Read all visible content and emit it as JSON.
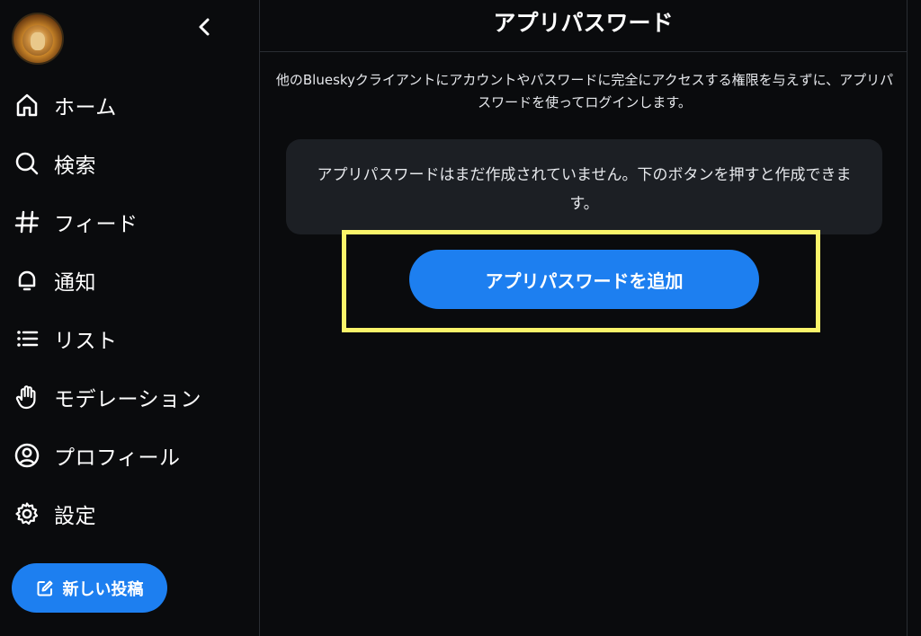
{
  "header": {
    "title": "アプリパスワード"
  },
  "main": {
    "description": "他のBlueskyクライアントにアカウントやパスワードに完全にアクセスする権限を与えずに、アプリパスワードを使ってログインします。",
    "empty_message": "アプリパスワードはまだ作成されていません。下のボタンを押すと作成できます。",
    "add_button_label": "アプリパスワードを追加"
  },
  "sidebar": {
    "items": [
      {
        "label": "ホーム",
        "icon": "home-icon"
      },
      {
        "label": "検索",
        "icon": "search-icon"
      },
      {
        "label": "フィード",
        "icon": "hash-icon"
      },
      {
        "label": "通知",
        "icon": "bell-icon"
      },
      {
        "label": "リスト",
        "icon": "list-icon"
      },
      {
        "label": "モデレーション",
        "icon": "hand-icon"
      },
      {
        "label": "プロフィール",
        "icon": "user-circle-icon"
      },
      {
        "label": "設定",
        "icon": "gear-icon"
      }
    ],
    "new_post_label": "新しい投稿"
  },
  "colors": {
    "background": "#0a0b0d",
    "accent": "#1d7ff0",
    "highlight": "#fbf46a",
    "card": "#1c1f24"
  }
}
